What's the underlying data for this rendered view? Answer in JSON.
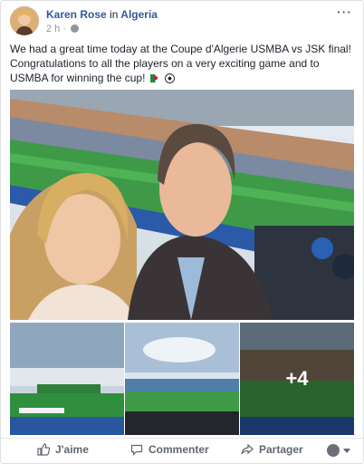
{
  "post": {
    "author": "Karen Rose",
    "location_prefix": "in",
    "location": "Algeria",
    "time": "2 h",
    "text": "We had a great time today at the Coupe d'Algerie USMBA vs JSK final! Congratulations to all the players on a very exciting game and to USMBA for winning the cup!",
    "more_icon": "···",
    "extra_photos": "+4"
  },
  "actions": {
    "like": "J'aime",
    "comment": "Commenter",
    "share": "Partager"
  },
  "colors": {
    "author_link": "#365899",
    "meta_grey": "#90949c",
    "action_grey": "#606770"
  }
}
